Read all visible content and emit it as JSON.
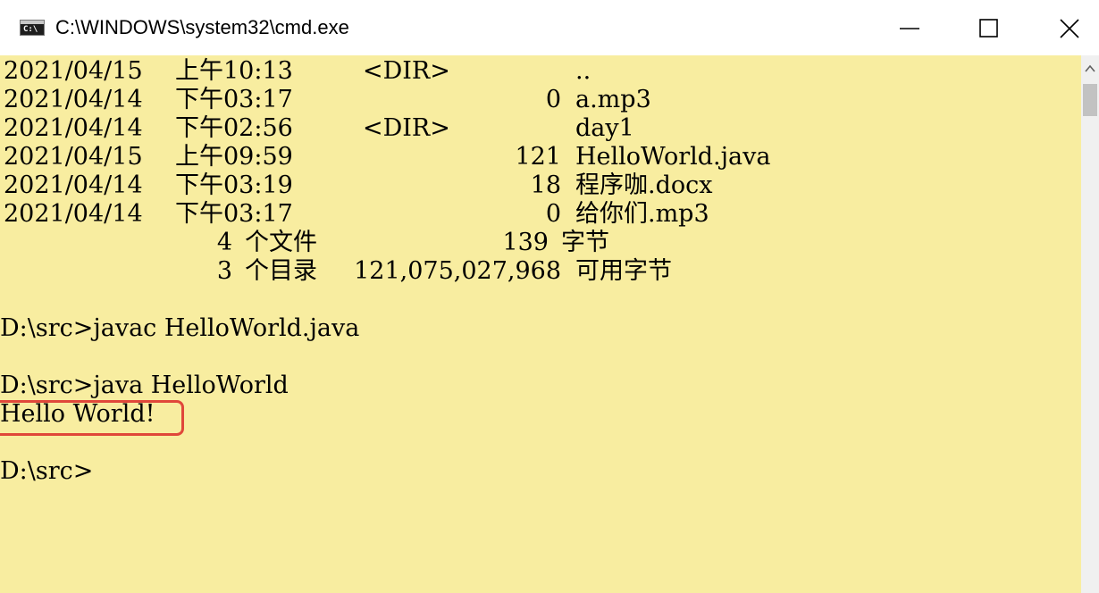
{
  "window": {
    "title": "C:\\WINDOWS\\system32\\cmd.exe",
    "icon": "cmd-console-icon",
    "icon_glyph": "C:\\",
    "controls": {
      "minimize": "minimize-icon",
      "maximize": "maximize-icon",
      "close": "close-icon"
    }
  },
  "colors": {
    "console_background": "#f8eda0",
    "console_text": "#000000",
    "highlight_border": "#e0473a",
    "titlebar_background": "#ffffff"
  },
  "listing": {
    "entries": [
      {
        "date": "2021/04/15",
        "time": "上午10:13",
        "dir": "<DIR>",
        "size": "",
        "name": ".."
      },
      {
        "date": "2021/04/14",
        "time": "下午03:17",
        "dir": "",
        "size": "0",
        "name": "a.mp3"
      },
      {
        "date": "2021/04/14",
        "time": "下午02:56",
        "dir": "<DIR>",
        "size": "",
        "name": "day1"
      },
      {
        "date": "2021/04/15",
        "time": "上午09:59",
        "dir": "",
        "size": "121",
        "name": "HelloWorld.java"
      },
      {
        "date": "2021/04/14",
        "time": "下午03:19",
        "dir": "",
        "size": "18",
        "name": "程序咖.docx"
      },
      {
        "date": "2021/04/14",
        "time": "下午03:17",
        "dir": "",
        "size": "0",
        "name": "给你们.mp3"
      }
    ],
    "summary_files": {
      "count": "4",
      "label": "个文件",
      "bytes": "139",
      "unit": "字节"
    },
    "summary_dirs": {
      "count": "3",
      "label": "个目录",
      "bytes": "121,075,027,968",
      "unit": "可用字节"
    }
  },
  "commands": [
    {
      "prompt": "D:\\src>",
      "command": "javac HelloWorld.java"
    },
    {
      "prompt": "D:\\src>",
      "command": "java HelloWorld"
    }
  ],
  "output": {
    "text": "Hello World!",
    "highlighted": true
  },
  "final_prompt": "D:\\src>",
  "scrollbar": {
    "up_arrow": "chevron-up-icon"
  }
}
